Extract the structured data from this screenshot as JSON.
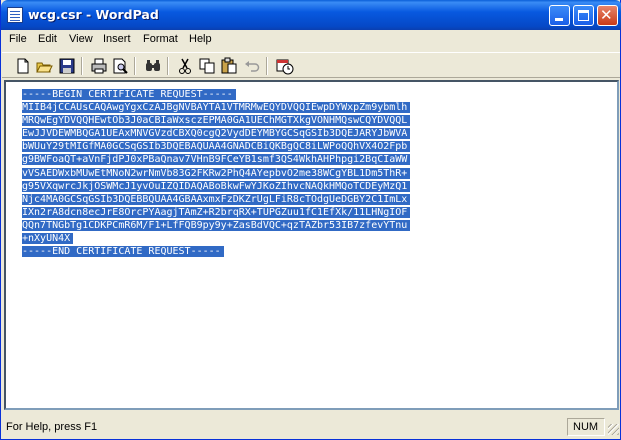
{
  "window": {
    "title": "wcg.csr - WordPad"
  },
  "menu": {
    "items": [
      "File",
      "Edit",
      "View",
      "Insert",
      "Format",
      "Help"
    ]
  },
  "toolbar": {
    "buttons": [
      "new-document-icon",
      "open-icon",
      "save-icon",
      "print-icon",
      "print-preview-icon",
      "find-icon",
      "cut-icon",
      "copy-icon",
      "paste-icon",
      "undo-icon",
      "date-time-icon"
    ]
  },
  "document": {
    "lines": [
      "-----BEGIN CERTIFICATE REQUEST-----",
      "MIIB4jCCAUsCAQAwgYgxCzAJBgNVBAYTA1VTMRMwEQYDVQQIEwpDYWxpZm9ybmlh",
      "MRQwEgYDVQQHEwtOb3J0aCBIaWxsczEPMA0GA1UEChMGTXkgVONHMQswCQYDVQQL",
      "EwJJVDEWMBQGA1UEAxMNVGVzdCBXQ0cgQ2VydDEYMBYGCSqGSIb3DQEJARYJbWVA",
      "bWUuY29tMIGfMA0GCSqGSIb3DQEBAQUAA4GNADCBiQKBgQC8iLWPoQQhVX4O2Fpb",
      "g9BWFoaQT+aVnFjdPJ0xPBaQnav7VHnB9FCeYB1smf3QS4WkhAHPhpgi2BqCIaWW",
      "vVSAEDWxbMUwEtMNoN2wrNmVb83G2FKRw2PhQ4AYepbvO2me38WCgYBL1Dm5ThR+",
      "g95VXqwrcJkjOSWMcJ1yvOuIZQIDAQABoBkwFwYJKoZIhvcNAQkHMQoTCDEyMzQ1",
      "Njc4MA0GCSqGSIb3DQEBBQUAA4GBAAxmxFzDKZrUgLFiR8cTOdgUeDGBY2C1ImLx",
      "IXn2rA8dcn8ecJrE8OrcPYAagjTAmZ+R2brqRX+TUPGZuu1fC1EfXk/11LHNgIOF",
      "QQn7TNGbTg1CDKPCmR6M/F1+LfFQB9py9y+ZasBdVQC+qzTAZbr53IB7zfevYTnu",
      "+nXyUN4X",
      "-----END CERTIFICATE REQUEST-----"
    ],
    "selection_color": "#316ac5"
  },
  "status": {
    "help_text": "For Help, press F1",
    "num_indicator": "NUM"
  }
}
